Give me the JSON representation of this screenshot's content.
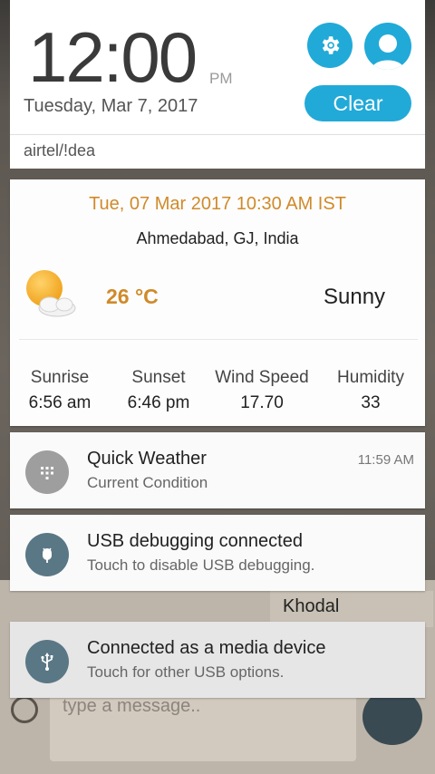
{
  "header": {
    "time": "12:00",
    "ampm": "PM",
    "date": "Tuesday, Mar 7, 2017",
    "clear_label": "Clear",
    "carrier": "airtel/!dea"
  },
  "weather": {
    "datetime": "Tue, 07 Mar 2017 10:30 AM IST",
    "location": "Ahmedabad,  GJ, India",
    "temperature": "26 °C",
    "condition": "Sunny",
    "stats": [
      {
        "label": "Sunrise",
        "value": "6:56 am"
      },
      {
        "label": "Sunset",
        "value": "6:46 pm"
      },
      {
        "label": "Wind Speed",
        "value": "17.70"
      },
      {
        "label": "Humidity",
        "value": "33"
      }
    ]
  },
  "notifications": [
    {
      "title": "Quick Weather",
      "subtitle": "Current Condition",
      "time": "11:59 AM",
      "icon": "dots-grid-icon"
    },
    {
      "title": "USB debugging connected",
      "subtitle": "Touch to disable USB debugging.",
      "time": "",
      "icon": "android-debug-icon"
    },
    {
      "title": "Connected as a media device",
      "subtitle": "Touch for other USB options.",
      "time": "",
      "icon": "usb-icon"
    }
  ],
  "background": {
    "contact_name": "Khodal",
    "message_placeholder": "type a message.."
  },
  "colors": {
    "accent": "#21a9d8",
    "weather_orange": "#d08a2a",
    "icon_gray": "#9e9e9e",
    "icon_slate": "#5a7786"
  }
}
